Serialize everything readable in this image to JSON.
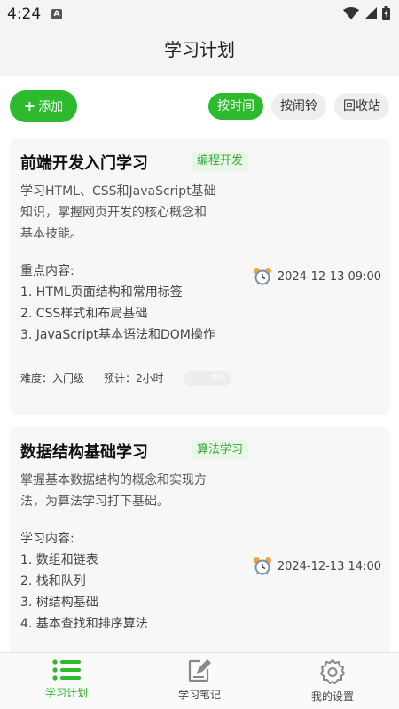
{
  "status_bar": {
    "time": "4:24",
    "notification_icon": "A"
  },
  "header": {
    "title": "学习计划"
  },
  "toolbar": {
    "add_label": "添加",
    "filters": [
      {
        "label": "按时间",
        "active": true
      },
      {
        "label": "按闹铃",
        "active": false
      },
      {
        "label": "回收站",
        "active": false
      }
    ]
  },
  "cards": [
    {
      "title": "前端开发入门学习",
      "tag": "编程开发",
      "description": [
        "学习HTML、CSS和JavaScript基础",
        "知识，掌握网页开发的核心概念和",
        "基本技能。"
      ],
      "content_heading": "重点内容:",
      "content_items": [
        "1. HTML页面结构和常用标签",
        "2. CSS样式和布局基础",
        "3. JavaScript基本语法和DOM操作"
      ],
      "due": "2024-12-13 09:00",
      "difficulty": "难度：入门级",
      "estimate": "预计：2小时",
      "progress_label": "0%",
      "progress_value": 0
    },
    {
      "title": "数据结构基础学习",
      "tag": "算法学习",
      "description": [
        "掌握基本数据结构的概念和实现方",
        "法，为算法学习打下基础。"
      ],
      "content_heading": "学习内容:",
      "content_items": [
        "1. 数组和链表",
        "2. 栈和队列",
        "3. 树结构基础",
        "4. 基本查找和排序算法"
      ],
      "due": "2024-12-13 14:00"
    }
  ],
  "bottom_nav": [
    {
      "label": "学习计划",
      "icon": "list-icon",
      "active": true
    },
    {
      "label": "学习笔记",
      "icon": "note-edit-icon",
      "active": false
    },
    {
      "label": "我的设置",
      "icon": "gear-icon",
      "active": false
    }
  ],
  "colors": {
    "accent": "#2dba2d",
    "tag_bg": "#e9f7e9",
    "tag_text": "#3aa63a"
  }
}
